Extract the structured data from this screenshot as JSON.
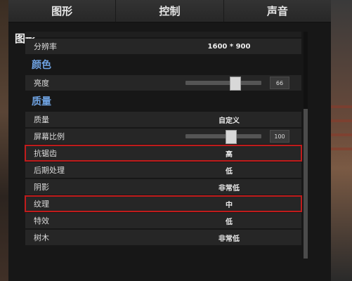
{
  "tabs": [
    "图形",
    "控制",
    "声音"
  ],
  "panel_title": "图形",
  "resolution": {
    "label": "分辨率",
    "value": "1600 * 900"
  },
  "color_section": "颜色",
  "brightness": {
    "label": "亮度",
    "value": "66",
    "level": 0.66
  },
  "quality_section": "质量",
  "rows": {
    "quality": {
      "label": "质量",
      "value": "自定义"
    },
    "screen_scale": {
      "label": "屏幕比例",
      "value": "100",
      "level": 0.6
    },
    "antialias": {
      "label": "抗锯齿",
      "value": "高"
    },
    "postprocess": {
      "label": "后期处理",
      "value": "低"
    },
    "shadow": {
      "label": "阴影",
      "value": "非常低"
    },
    "texture": {
      "label": "纹理",
      "value": "中"
    },
    "effects": {
      "label": "特效",
      "value": "低"
    },
    "trees": {
      "label": "树木",
      "value": "非常低"
    }
  },
  "highlight_color": "#c01c1c",
  "section_color": "#6ea1e0"
}
